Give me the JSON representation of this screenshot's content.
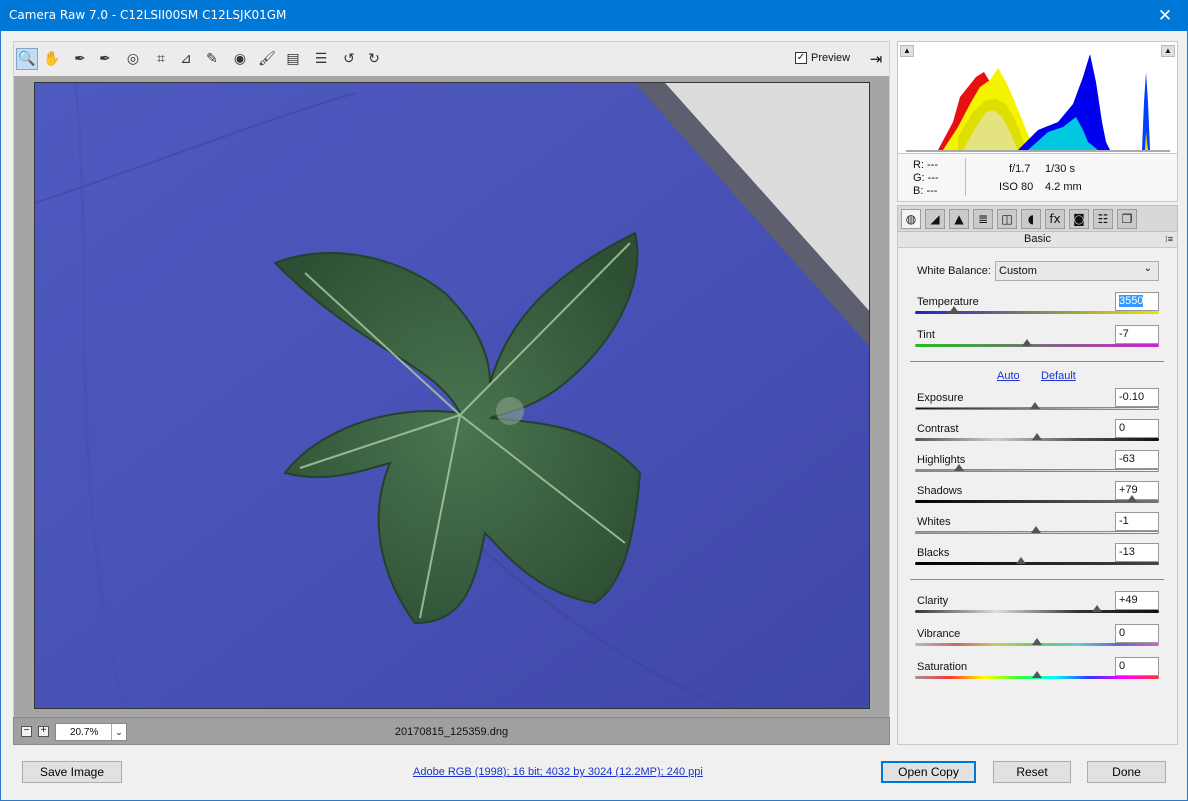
{
  "window": {
    "title": "Camera Raw 7.0  -  C12LSII00SM C12LSJK01GM",
    "close_glyph": "✕"
  },
  "toolbar": {
    "tools": [
      {
        "name": "zoom-tool-icon",
        "glyph": "🔍",
        "active": true
      },
      {
        "name": "hand-tool-icon",
        "glyph": "✋"
      },
      {
        "name": "white-balance-tool-icon",
        "glyph": "✒"
      },
      {
        "name": "color-sampler-tool-icon",
        "glyph": "✒"
      },
      {
        "name": "targeted-adjustment-tool-icon",
        "glyph": "◎"
      },
      {
        "name": "crop-tool-icon",
        "glyph": "⌗"
      },
      {
        "name": "straighten-tool-icon",
        "glyph": "⊿"
      },
      {
        "name": "spot-removal-tool-icon",
        "glyph": "✎"
      },
      {
        "name": "red-eye-tool-icon",
        "glyph": "◉"
      },
      {
        "name": "adjustment-brush-icon",
        "glyph": "🖌"
      },
      {
        "name": "graduated-filter-icon",
        "glyph": "▤"
      },
      {
        "name": "preferences-icon",
        "glyph": "☰"
      },
      {
        "name": "rotate-ccw-icon",
        "glyph": "↺"
      },
      {
        "name": "rotate-cw-icon",
        "glyph": "↻"
      }
    ],
    "preview_label": "Preview",
    "preview_checked": "✓",
    "fullscreen_glyph": "⇥"
  },
  "image_footer": {
    "zoom_out": "−",
    "zoom_in": "+",
    "zoom_value": "20.7%",
    "zoom_arrow": "⌄",
    "filename": "20170815_125359.dng"
  },
  "histogram": {
    "shadow_clip_glyph": "▲",
    "highlight_clip_glyph": "▲"
  },
  "readout": {
    "r": "R:   ---",
    "g": "G:   ---",
    "b": "B:   ---",
    "aperture": "f/1.7",
    "shutter": "1/30 s",
    "iso": "ISO 80",
    "focal": "4.2 mm"
  },
  "panel_tabs": [
    {
      "name": "tab-basic-icon",
      "glyph": "◍",
      "active": true
    },
    {
      "name": "tab-tone-curve-icon",
      "glyph": "◢"
    },
    {
      "name": "tab-detail-icon",
      "glyph": "▲"
    },
    {
      "name": "tab-hsl-icon",
      "glyph": "≣"
    },
    {
      "name": "tab-split-toning-icon",
      "glyph": "◫"
    },
    {
      "name": "tab-lens-corrections-icon",
      "glyph": "◖"
    },
    {
      "name": "tab-effects-icon",
      "glyph": "fx"
    },
    {
      "name": "tab-camera-calibration-icon",
      "glyph": "◙"
    },
    {
      "name": "tab-presets-icon",
      "glyph": "☷"
    },
    {
      "name": "tab-snapshots-icon",
      "glyph": "❐"
    }
  ],
  "panel": {
    "title": "Basic",
    "menu_glyph": "⁝≡",
    "white_balance_label": "White Balance:",
    "white_balance_value": "Custom",
    "auto_label": "Auto",
    "default_label": "Default"
  },
  "sliders": {
    "temperature": {
      "label": "Temperature",
      "value": "3550",
      "position": 0.16
    },
    "tint": {
      "label": "Tint",
      "value": "-7",
      "position": 0.46
    },
    "exposure": {
      "label": "Exposure",
      "value": "-0.10",
      "position": 0.49
    },
    "contrast": {
      "label": "Contrast",
      "value": "0",
      "position": 0.5
    },
    "highlights": {
      "label": "Highlights",
      "value": "-63",
      "position": 0.18
    },
    "shadows": {
      "label": "Shadows",
      "value": "+79",
      "position": 0.89
    },
    "whites": {
      "label": "Whites",
      "value": "-1",
      "position": 0.495
    },
    "blacks": {
      "label": "Blacks",
      "value": "-13",
      "position": 0.435
    },
    "clarity": {
      "label": "Clarity",
      "value": "+49",
      "position": 0.745
    },
    "vibrance": {
      "label": "Vibrance",
      "value": "0",
      "position": 0.5
    },
    "saturation": {
      "label": "Saturation",
      "value": "0",
      "position": 0.5
    }
  },
  "footer": {
    "save_label": "Save Image",
    "workflow_link": "Adobe RGB (1998); 16 bit; 4032 by 3024 (12.2MP); 240 ppi",
    "open_label": "Open Copy",
    "reset_label": "Reset",
    "done_label": "Done"
  },
  "colors": {
    "titlebar": "#0078d7",
    "link": "#1a33cc",
    "cloth": "#4a54b8",
    "leaf": "#34593a"
  }
}
